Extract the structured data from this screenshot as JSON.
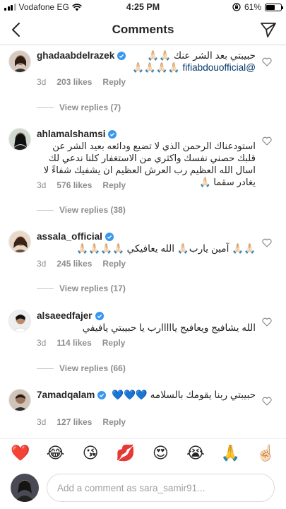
{
  "status_bar": {
    "carrier": "Vodafone EG",
    "time": "4:25 PM",
    "battery": "61%",
    "battery_level": 0.61,
    "signal_bars": 3,
    "signal_total": 4
  },
  "nav": {
    "title": "Comments"
  },
  "colors": {
    "verified": "#3897f0",
    "link": "#003569",
    "meta": "#8e8e8e",
    "divider": "#dbdbdb"
  },
  "comments": [
    {
      "username": "ghadaabdelrazek",
      "text": "حبيبتي بعد الشر عنك 🙏🏻🙏🏻",
      "mention": "@fifiabdouofficial",
      "trail": "🙏🏻🙏🏻🙏🏻🙏🏻",
      "time": "3d",
      "likes": "203 likes",
      "reply": "Reply",
      "view_replies": "View replies (7)"
    },
    {
      "username": "ahlamalshamsi",
      "text": "استودعناك الرحمن الذي لا تضيع ودائعه بعيد الشر عن قلبك حصني نفسك واكثري من الاستغفار كلنا ندعي لك اسال الله العظيم رب العرش العظيم ان يشفيك شفاءً لا يغادر سقما 🙏🏻",
      "time": "3d",
      "likes": "576 likes",
      "reply": "Reply",
      "view_replies": "View replies (38)"
    },
    {
      "username": "assala_official",
      "text": "🙏🏻🙏🏻 آمين يارب🙏🏻 الله يعافيكي 🙏🏻🙏🏻🙏🏻🙏🏻",
      "time": "3d",
      "likes": "245 likes",
      "reply": "Reply",
      "view_replies": "View replies (17)"
    },
    {
      "username": "alsaeedfajer",
      "text": "الله يشافيج ويعافيج يااااارب يا حبيبتي يافيفي",
      "time": "3d",
      "likes": "114 likes",
      "reply": "Reply",
      "view_replies": "View replies (66)"
    },
    {
      "username": "7amadqalam",
      "text": "حبيبتي ربنا يقومك بالسلامه 💙💙💙",
      "time": "3d",
      "likes": "127 likes",
      "reply": "Reply"
    }
  ],
  "emojis": [
    {
      "char": "❤️",
      "name": "red-heart"
    },
    {
      "char": "😂",
      "name": "tears-of-joy"
    },
    {
      "char": "😘",
      "name": "kiss-face"
    },
    {
      "char": "💋",
      "name": "kiss-mark"
    },
    {
      "char": "😍",
      "name": "heart-eyes"
    },
    {
      "char": "😭",
      "name": "crying"
    },
    {
      "char": "🙏",
      "name": "pray"
    },
    {
      "char": "☝🏻",
      "name": "point-up"
    }
  ],
  "comment_input": {
    "placeholder": "Add a comment as sara_samir91..."
  }
}
